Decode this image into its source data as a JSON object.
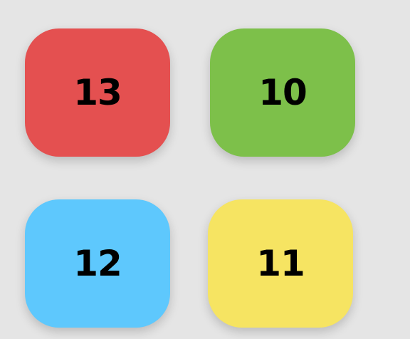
{
  "tiles": [
    {
      "value": "13",
      "color": "#e45050"
    },
    {
      "value": "10",
      "color": "#7dc04a"
    },
    {
      "value": "12",
      "color": "#5ec8fd"
    },
    {
      "value": "11",
      "color": "#f6e462"
    }
  ],
  "colors": {
    "background": "#e5e5e5",
    "text": "#000000"
  }
}
